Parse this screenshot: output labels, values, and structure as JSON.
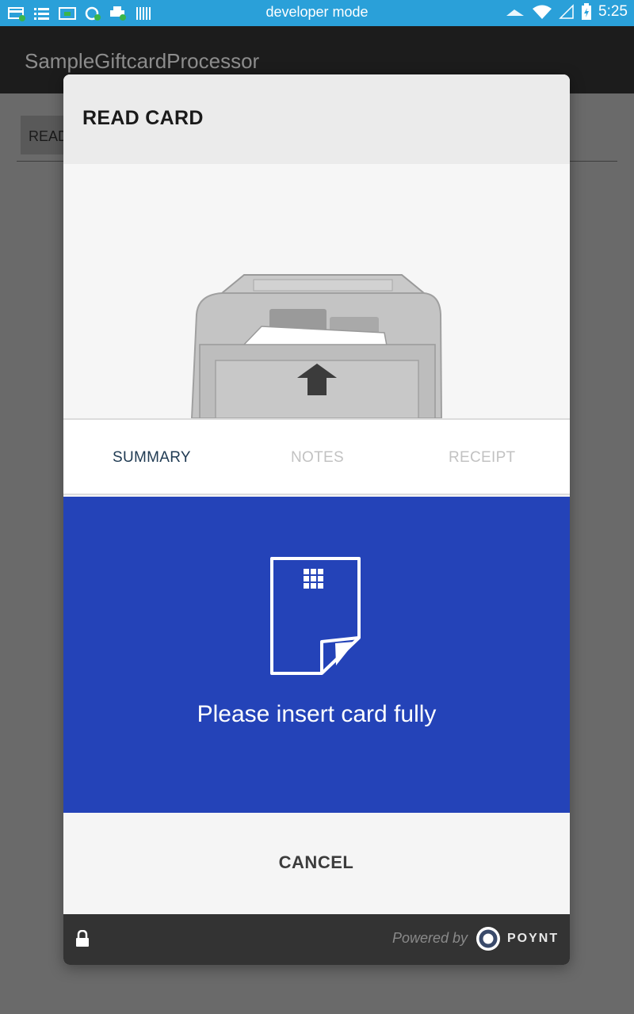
{
  "status_bar": {
    "title": "developer mode",
    "time": "5:25",
    "left_icons": [
      "notification-card-icon",
      "list-icon",
      "screen-icon",
      "sync-icon",
      "printer-icon",
      "barcode-icon"
    ],
    "right_icons": [
      "signal-icon",
      "wifi-icon",
      "sim-icon",
      "battery-charging-icon"
    ]
  },
  "app_bar": {
    "title": "SampleGiftcardProcessor"
  },
  "underlay": {
    "button_label": "READ"
  },
  "dialog": {
    "title": "READ CARD",
    "tabs": [
      {
        "label": "SUMMARY",
        "active": true
      },
      {
        "label": "NOTES",
        "active": false
      },
      {
        "label": "RECEIPT",
        "active": false
      }
    ],
    "prompt": "Please insert card fully",
    "cancel_label": "CANCEL",
    "footer": {
      "powered_by": "Powered by",
      "brand": "POYNT"
    }
  },
  "colors": {
    "status_bar": "#2aa0d9",
    "app_bar": "#1c1c1c",
    "scrim": "#6a6a6a",
    "prompt_panel": "#2443b8",
    "footer": "#333333",
    "active_tab": "#1f3a52",
    "inactive_tab": "#c2c2c2"
  }
}
